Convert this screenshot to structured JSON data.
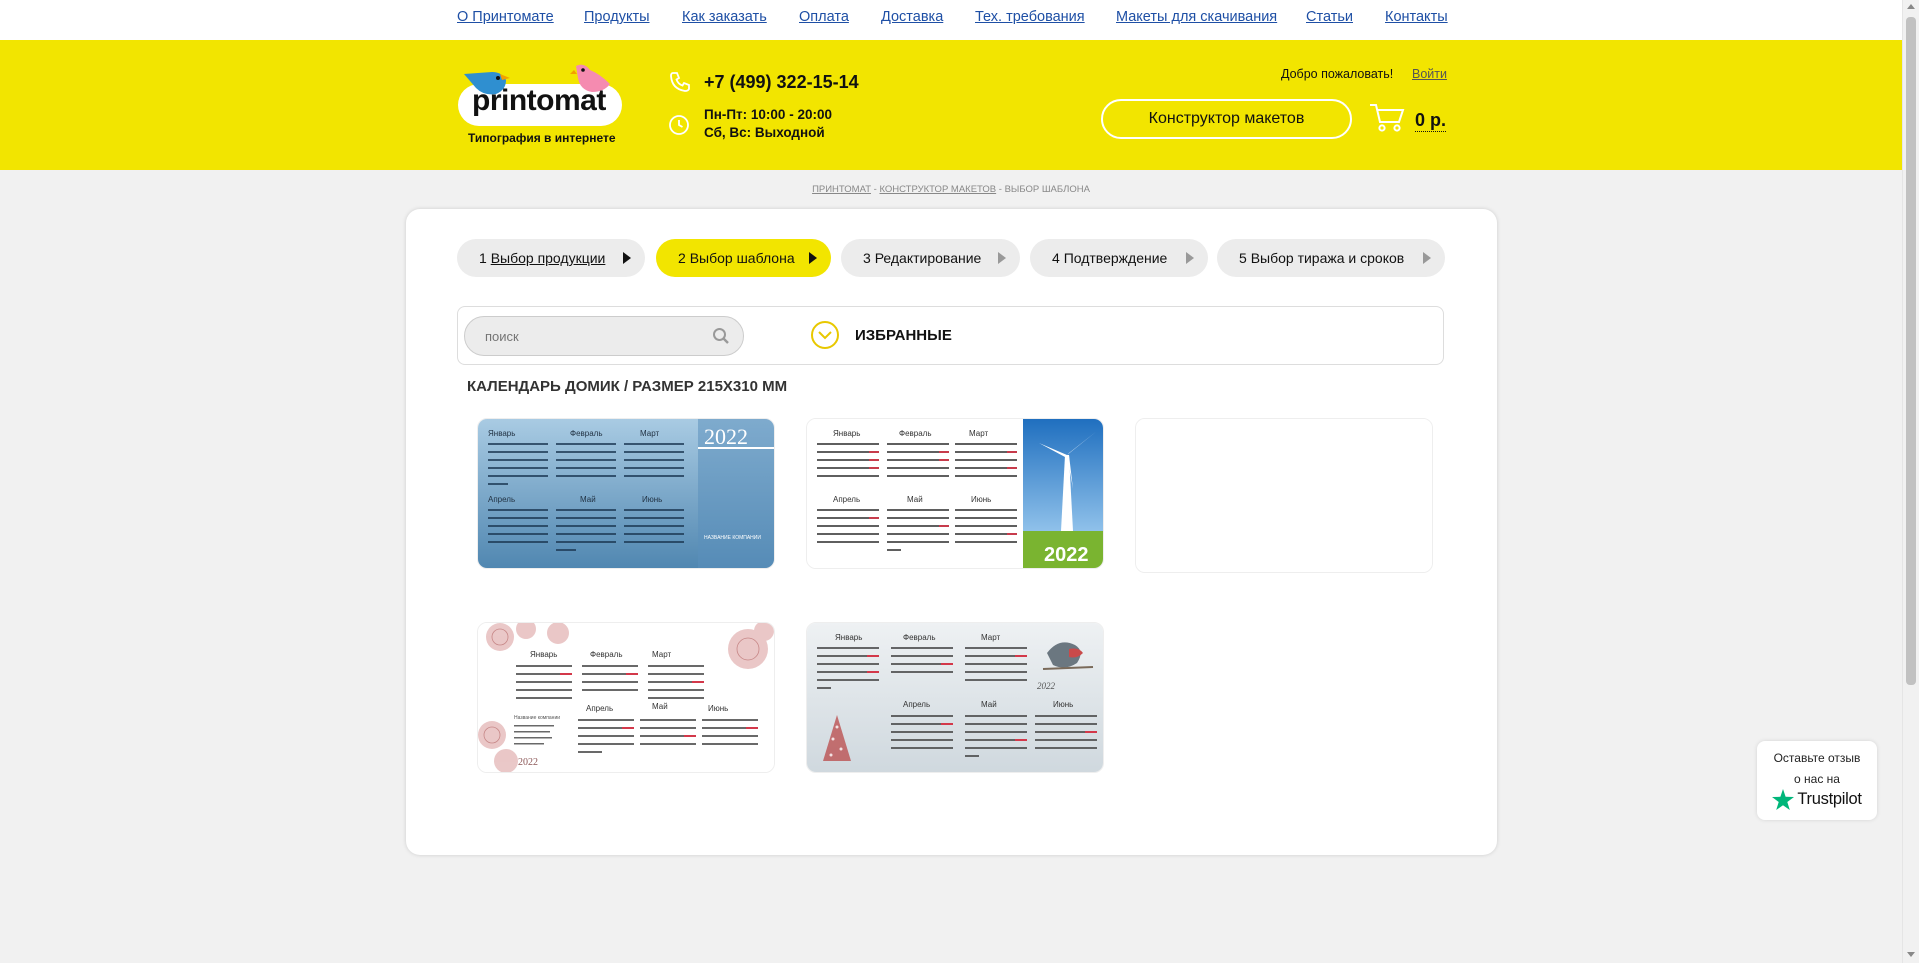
{
  "topnav": {
    "items": [
      "О Принтомате",
      "Продукты",
      "Как заказать",
      "Оплата",
      "Доставка",
      "Тех. требования",
      "Макеты для скачивания",
      "Статьи",
      "Контакты"
    ]
  },
  "header": {
    "logo_text": "printomat",
    "tagline": "Типография в интернете",
    "phone": "+7 (499) 322-15-14",
    "hours_weekdays": "Пн-Пт: 10:00 - 20:00",
    "hours_weekend": "Сб, Вс: Выходной",
    "welcome": "Добро пожаловать!",
    "login": "Войти",
    "constructor_button": "Конструктор макетов",
    "cart_total": "0 р.",
    "colors": {
      "brand_yellow": "#f2e500"
    }
  },
  "breadcrumb": {
    "items": [
      "ПРИНТОМАТ",
      "КОНСТРУКТОР МАКЕТОВ",
      "ВЫБОР ШАБЛОНА"
    ],
    "separator": "-"
  },
  "steps": [
    {
      "num": "1",
      "label": "Выбор продукции",
      "state": "done"
    },
    {
      "num": "2",
      "label": "Выбор шаблона",
      "state": "active"
    },
    {
      "num": "3",
      "label": "Редактирование",
      "state": "pending"
    },
    {
      "num": "4",
      "label": "Подтверждение",
      "state": "pending"
    },
    {
      "num": "5",
      "label": "Выбор тиража и сроков",
      "state": "pending"
    }
  ],
  "search": {
    "placeholder": "поиск"
  },
  "favorites": {
    "label": "ИЗБРАННЫЕ"
  },
  "section_title": "КАЛЕНДАРЬ ДОМИК / РАЗМЕР 215Х310 ММ",
  "templates": [
    {
      "style": "blue",
      "year": "2022",
      "company": "НАЗВАНИЕ КОМПАНИИ"
    },
    {
      "style": "windmill",
      "year": "2022"
    },
    {
      "style": "blank"
    },
    {
      "style": "floral",
      "year": "2022",
      "company": "Название компании"
    },
    {
      "style": "winter-bird",
      "year": "2022"
    }
  ],
  "calendar_months": {
    "top": [
      "Январь",
      "Февраль",
      "Март"
    ],
    "bottom": [
      "Апрель",
      "Май",
      "Июнь"
    ]
  },
  "trustpilot": {
    "line1": "Оставьте отзыв",
    "line2": "о нас на",
    "brand": "Trustpilot",
    "star_color": "#00b67a"
  }
}
